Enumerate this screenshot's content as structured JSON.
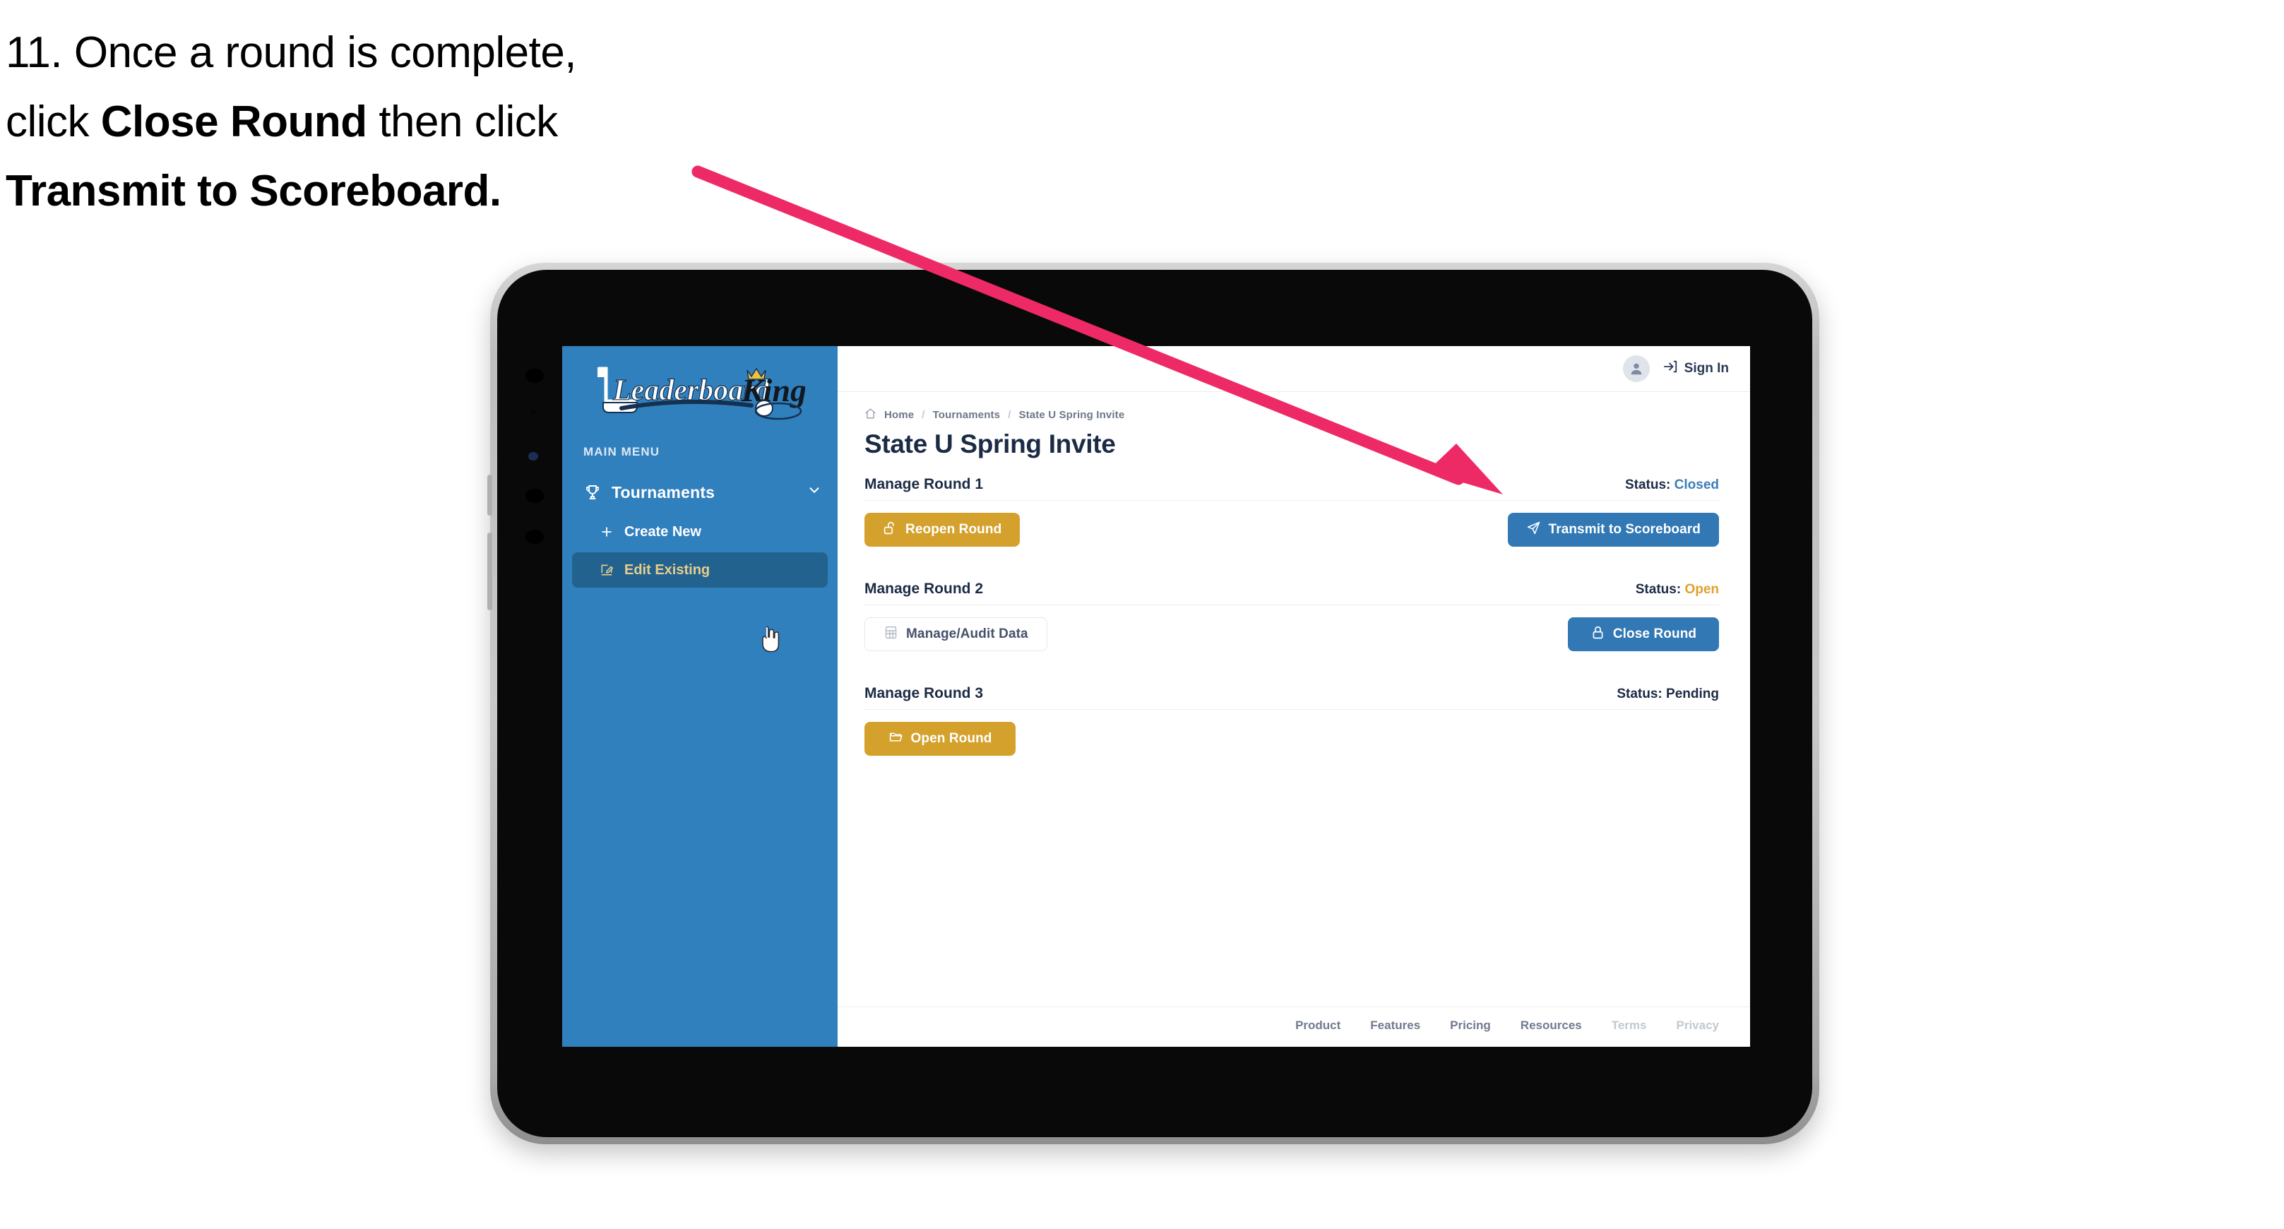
{
  "caption": {
    "line1_plain": "11. Once a round is complete,",
    "line2_pre": "click ",
    "line2_bold": "Close Round",
    "line2_post": " then click",
    "line3_bold": "Transmit to Scoreboard."
  },
  "colors": {
    "sidebar_blue": "#3180BE",
    "sidebar_active_blue": "#22628F",
    "active_text_gold": "#E8CE8C",
    "button_blue": "#3178B5",
    "button_gold": "#D4A12C",
    "status_closed": "#3C7EB8",
    "status_open": "#E0A12B",
    "status_pending": "#1c2b45",
    "arrow_pink": "#EE2A66",
    "title_navy": "#1c2b45"
  },
  "sidebar": {
    "logo_text_left": "Leaderboard",
    "logo_text_right": "King",
    "menu_label": "MAIN MENU",
    "nav": [
      {
        "label": "Tournaments",
        "icon": "trophy-icon",
        "chevron": "chevron-down-icon"
      }
    ],
    "sub_items": [
      {
        "label": "Create New",
        "icon": "plus-icon",
        "active": false
      },
      {
        "label": "Edit Existing",
        "icon": "pencil-square-icon",
        "active": true
      }
    ]
  },
  "topbar": {
    "avatar_icon": "user-avatar-icon",
    "signin_icon": "sign-in-arrow-icon",
    "signin_label": "Sign In"
  },
  "breadcrumb": {
    "home_icon": "home-icon",
    "items": [
      "Home",
      "Tournaments",
      "State U Spring Invite"
    ],
    "separator": "/"
  },
  "page": {
    "title": "State U Spring Invite"
  },
  "rounds": [
    {
      "name": "Manage Round 1",
      "status_label": "Status:",
      "status_value": "Closed",
      "status_kind": "closed",
      "left_button": {
        "label": "Reopen Round",
        "icon": "unlock-icon",
        "style": "gold"
      },
      "right_button": {
        "label": "Transmit to Scoreboard",
        "icon": "paper-plane-icon",
        "style": "blue"
      }
    },
    {
      "name": "Manage Round 2",
      "status_label": "Status:",
      "status_value": "Open",
      "status_kind": "open",
      "left_button": {
        "label": "Manage/Audit Data",
        "icon": "table-grid-icon",
        "style": "ghost"
      },
      "right_button": {
        "label": "Close Round",
        "icon": "lock-icon",
        "style": "blue"
      }
    },
    {
      "name": "Manage Round 3",
      "status_label": "Status:",
      "status_value": "Pending",
      "status_kind": "pending",
      "left_button": {
        "label": "Open Round",
        "icon": "folder-open-icon",
        "style": "gold"
      },
      "right_button": null
    }
  ],
  "footer": {
    "links": [
      {
        "label": "Product",
        "muted": false
      },
      {
        "label": "Features",
        "muted": false
      },
      {
        "label": "Pricing",
        "muted": false
      },
      {
        "label": "Resources",
        "muted": false
      },
      {
        "label": "Terms",
        "muted": true
      },
      {
        "label": "Privacy",
        "muted": true
      }
    ]
  }
}
